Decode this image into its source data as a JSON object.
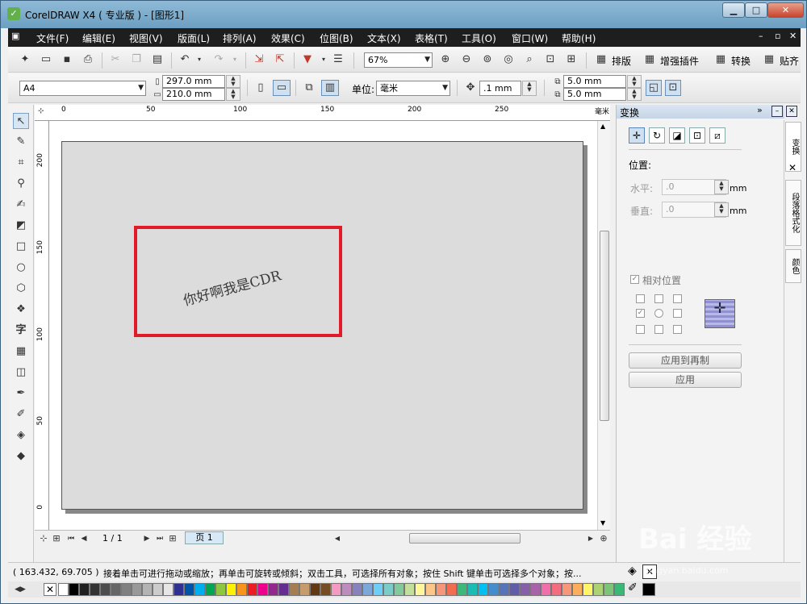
{
  "window": {
    "title": "CorelDRAW X4 ( 专业版 ) - [图形1]",
    "minimize_label": "▁",
    "maximize_label": "□",
    "close_label": "✕"
  },
  "menu": {
    "items": [
      "文件(F)",
      "编辑(E)",
      "视图(V)",
      "版面(L)",
      "排列(A)",
      "效果(C)",
      "位图(B)",
      "文本(X)",
      "表格(T)",
      "工具(O)",
      "窗口(W)",
      "帮助(H)"
    ]
  },
  "toolbar": {
    "zoom_value": "67%",
    "layout_label": "排版",
    "plugin_label": "增强插件",
    "convert_label": "转换",
    "paste_label": "贴齐"
  },
  "propbar": {
    "paper_size": "A4",
    "width": "297.0 mm",
    "height": "210.0 mm",
    "unit_label": "单位:",
    "unit_value": "毫米",
    "nudge": ".1 mm",
    "dup_x": "5.0 mm",
    "dup_y": "5.0 mm"
  },
  "ruler": {
    "h_labels": [
      "0",
      "50",
      "100",
      "150",
      "200",
      "250"
    ],
    "unit": "毫米",
    "v_labels": [
      "200",
      "150",
      "100",
      "50",
      "0"
    ]
  },
  "canvas": {
    "artistic_text": "你好啊我是CDR"
  },
  "page_nav": {
    "counter": "1 / 1",
    "tab": "页 1"
  },
  "docker": {
    "title": "变换",
    "position_heading": "位置:",
    "horizontal_label": "水平:",
    "vertical_label": "垂直:",
    "horizontal_value": ".0",
    "vertical_value": ".0",
    "unit": "mm",
    "relative_label": "相对位置",
    "apply_dup_label": "应用到再制",
    "apply_label": "应用",
    "side_tabs": [
      "变换",
      "段落格式化",
      "颜色"
    ]
  },
  "status": {
    "coords": "( 163.432, 69.705 )",
    "hint": "接着单击可进行拖动或缩放；再单击可旋转或倾斜；双击工具，可选择所有对象；按住 Shift 键单击可选择多个对象；按..."
  },
  "watermark": {
    "text": "Bai 经验",
    "url": "jingyan.baidu.com"
  },
  "palette_colors": [
    "#ffffff",
    "#000000",
    "#1f1f1f",
    "#333333",
    "#4d4d4d",
    "#666666",
    "#808080",
    "#999999",
    "#b3b3b3",
    "#cccccc",
    "#e6e6e6",
    "#2e3192",
    "#0054a6",
    "#00aeef",
    "#00a651",
    "#8dc63f",
    "#fff200",
    "#f7941d",
    "#ed1c24",
    "#ec008c",
    "#92278f",
    "#662d91",
    "#a67c52",
    "#c69c6d",
    "#603913",
    "#754c24",
    "#f49ac2",
    "#bd8cbf",
    "#8781bd",
    "#7da7d9",
    "#6dcff6",
    "#7accc8",
    "#82ca9c",
    "#c4df9b",
    "#fff799",
    "#fdc689",
    "#f69679",
    "#f26c4f",
    "#3cb878",
    "#1cbbb4",
    "#00bff3",
    "#448ccb",
    "#5674b9",
    "#605ca8",
    "#855fa8",
    "#a863a8",
    "#f06eaa",
    "#f26d7d",
    "#f7977a",
    "#fbaf5d",
    "#fff568",
    "#acd373",
    "#7cc576",
    "#3bb878",
    "#1abbb4",
    "#00bff3"
  ]
}
